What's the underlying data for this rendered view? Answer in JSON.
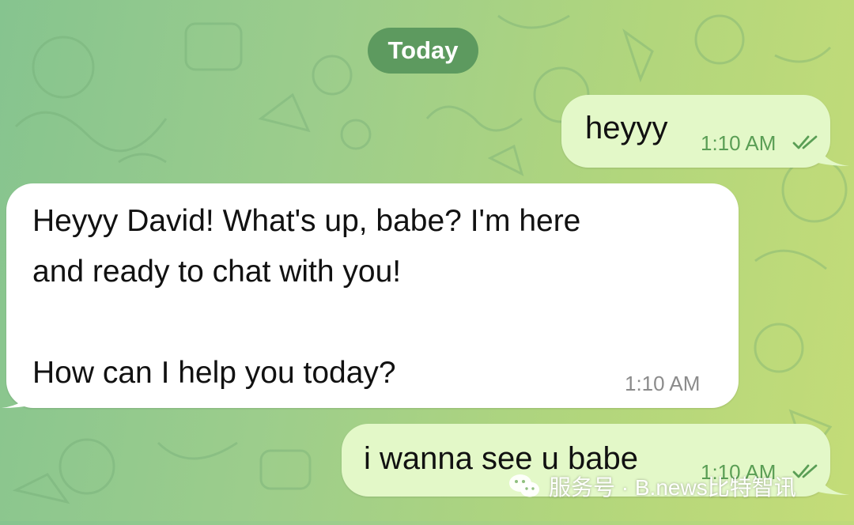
{
  "chat": {
    "date_separator": "Today",
    "messages": [
      {
        "direction": "outgoing",
        "text": "heyyy",
        "time": "1:10 AM",
        "status_icon": "double-check-icon"
      },
      {
        "direction": "incoming",
        "lines": [
          "Heyyy David! What's up, babe? I'm here",
          "and ready to chat with you!",
          "",
          "How can I help you today?"
        ],
        "time": "1:10 AM"
      },
      {
        "direction": "outgoing",
        "text": "i wanna see u babe",
        "time": "1:10 AM",
        "status_icon": "double-check-icon"
      }
    ]
  },
  "watermark": {
    "icon": "wechat-icon",
    "text": "服务号 · B.news比特智讯"
  },
  "colors": {
    "wallpaper_left": "#86c48f",
    "wallpaper_right": "#c4dc78",
    "outgoing_bubble": "#e3f8c8",
    "incoming_bubble": "#ffffff",
    "date_pill": "#5d9a5f",
    "outgoing_time": "#5a9e55",
    "incoming_time": "#8b8b8b"
  }
}
